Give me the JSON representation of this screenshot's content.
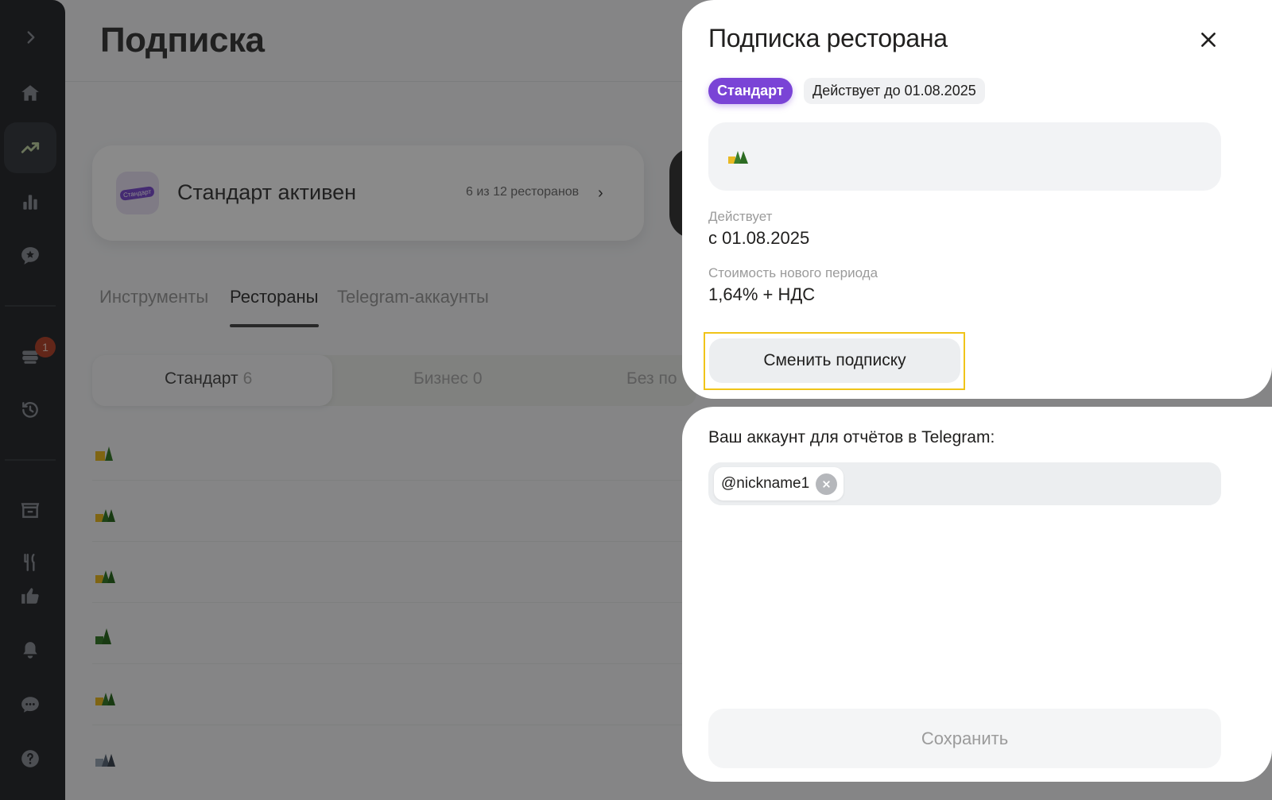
{
  "page": {
    "title": "Подписка",
    "subscription_card": {
      "title": "Стандарт активен",
      "logo_label": "Стандарт",
      "count": "6 из 12 ресторанов"
    },
    "tabs": [
      {
        "label": "Инструменты",
        "active": false
      },
      {
        "label": "Рестораны",
        "active": true
      },
      {
        "label": "Telegram-аккаунты",
        "active": false
      }
    ],
    "segments": [
      {
        "label": "Стандарт",
        "count": "6",
        "active": true
      },
      {
        "label": "Бизнес",
        "count": "0",
        "active": false
      },
      {
        "label": "Без по",
        "count": "",
        "active": false
      }
    ],
    "restaurant_rows": 6
  },
  "sidebar": {
    "items": [
      "expand-icon",
      "home-icon",
      "trending-icon",
      "bar-chart-icon",
      "star-chat-icon",
      "orders-icon",
      "history-icon",
      "store-icon",
      "food-icon",
      "like-icon",
      "bell-icon",
      "chat-icon",
      "help-icon"
    ],
    "badge": "1",
    "active_color": "#c2d4a4"
  },
  "panel": {
    "title": "Подписка ресторана",
    "plan_tag": "Стандарт",
    "valid_tag": "Действует до 01.08.2025",
    "valid_label": "Действует",
    "valid_value": "с 01.08.2025",
    "cost_label": "Стоимость нового периода",
    "cost_value": "1,64% + НДС",
    "change_button": "Сменить подписку",
    "telegram_label": "Ваш аккаунт для отчётов в Telegram:",
    "telegram_chip": "@nickname1",
    "save_button": "Сохранить"
  },
  "colors": {
    "accent_purple": "#7a44d6",
    "highlight_frame": "#f0c419",
    "overlay": "rgba(0,0,0,0.45)"
  }
}
